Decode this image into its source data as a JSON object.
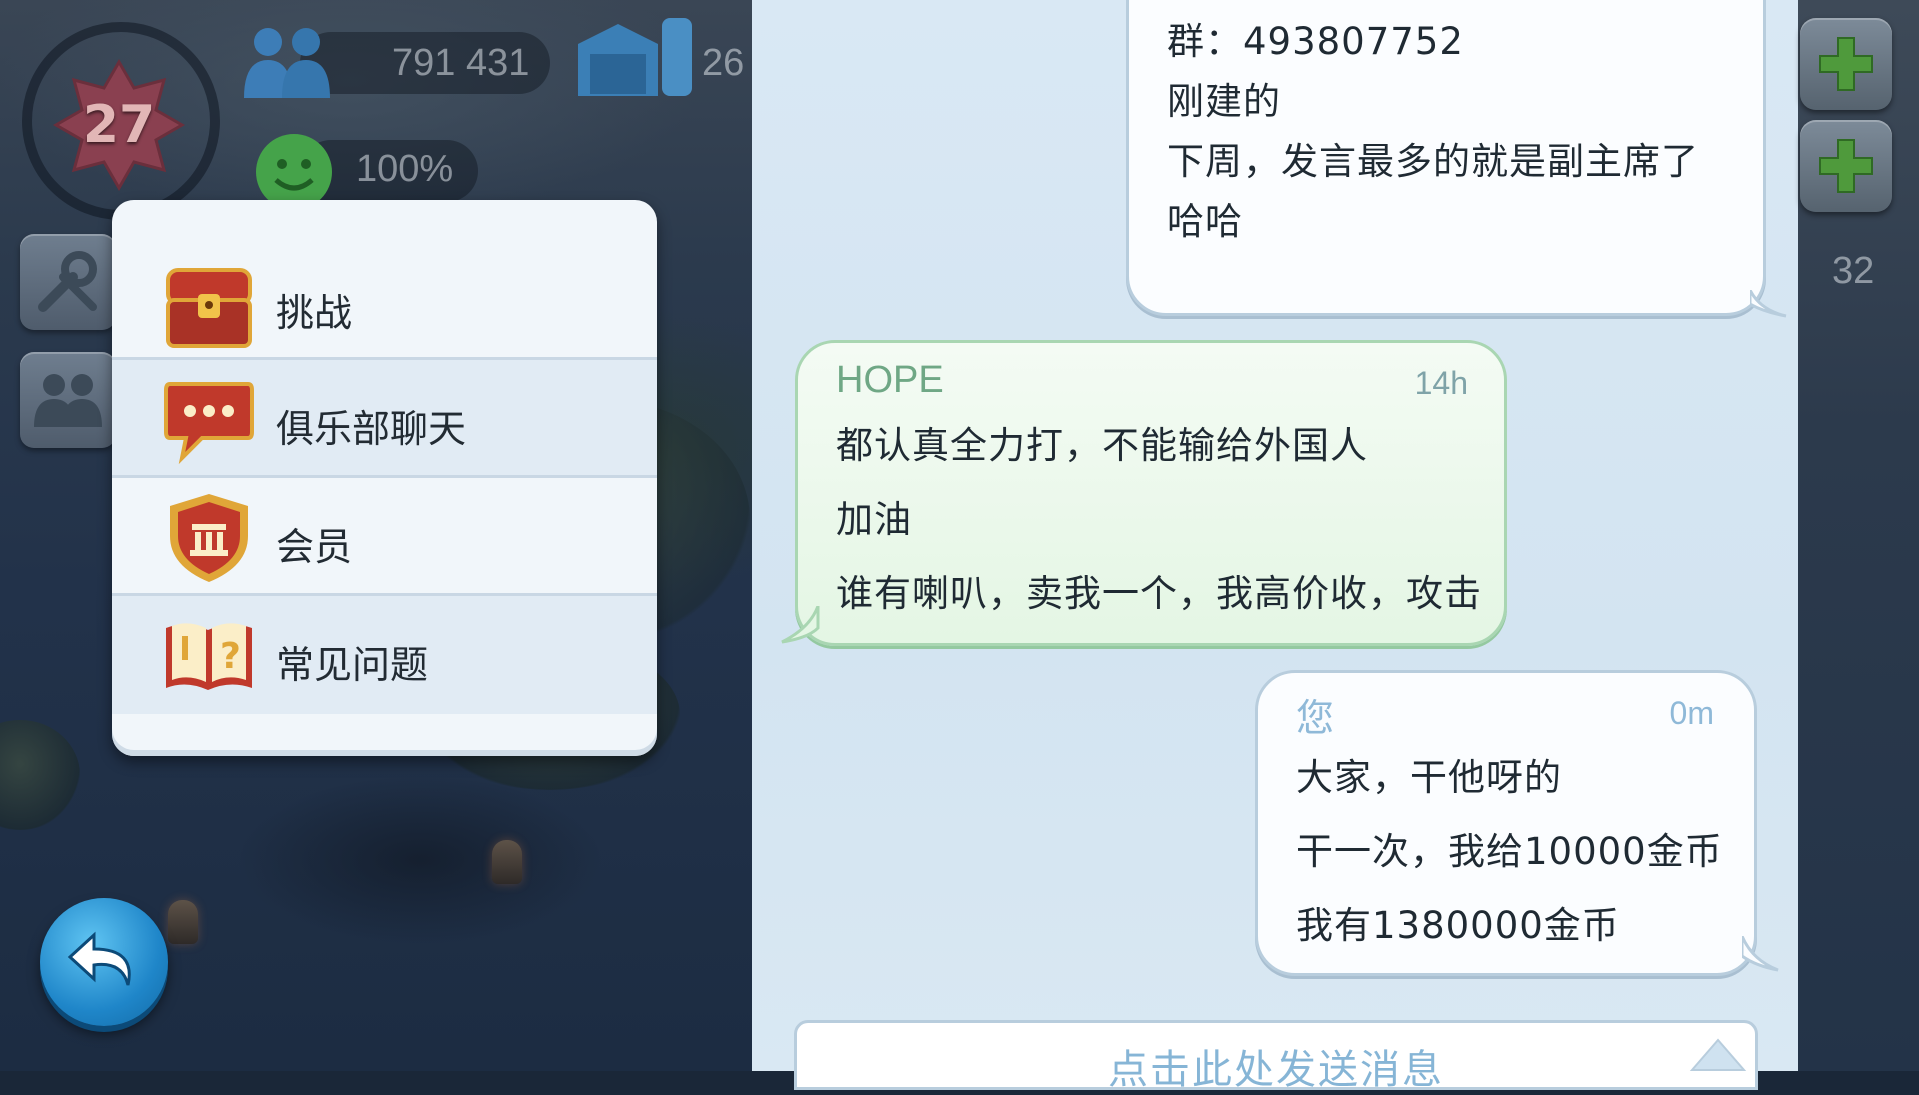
{
  "hud": {
    "level": "27",
    "population": "791 431",
    "storage": "26",
    "happiness": "100%",
    "side_count": "32"
  },
  "club_menu": {
    "items": [
      {
        "label": "挑战",
        "icon": "treasure-chest-icon"
      },
      {
        "label": "俱乐部聊天",
        "icon": "chat-bubble-icon"
      },
      {
        "label": "会员",
        "icon": "shield-icon"
      },
      {
        "label": "常见问题",
        "icon": "question-book-icon"
      }
    ]
  },
  "chat": {
    "messages": [
      {
        "lines": [
          "群：493807752",
          "刚建的",
          "下周，发言最多的就是副主席了",
          "哈哈"
        ]
      },
      {
        "sender": "HOPE",
        "time": "14h",
        "lines": [
          "都认真全力打，不能输给外国人",
          "加油",
          "谁有喇叭，卖我一个，我高价收，攻击"
        ]
      },
      {
        "sender": "您",
        "time": "0m",
        "lines": [
          "大家，干他呀的",
          "干一次，我给10000金币",
          "我有1380000金币"
        ]
      }
    ],
    "input_placeholder": "点击此处发送消息"
  },
  "colors": {
    "hope_name": "#6fa785",
    "mine_name": "#8fb9d8",
    "time_hope": "#7fa3a8",
    "time_mine": "#8fb9d8"
  }
}
